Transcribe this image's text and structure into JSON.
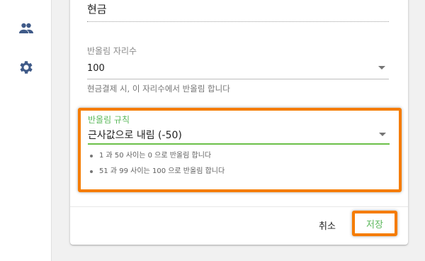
{
  "sidebar": {
    "items": [
      {
        "icon": "users-icon"
      },
      {
        "icon": "gear-icon"
      }
    ]
  },
  "form": {
    "payment_method_value": "현금",
    "digits": {
      "label": "반올림 자리수",
      "value": "100",
      "hint": "현금결제 시, 이 자리수에서 반올림 합니다"
    },
    "rule": {
      "label": "반올림 규칙",
      "value": "근사값으로 내림 (-50)",
      "notes": [
        "1 과 50 사이는 0 으로 반올림 합니다",
        "51 과 99 사이는 100 으로 반올림 합니다"
      ]
    }
  },
  "actions": {
    "cancel_label": "취소",
    "save_label": "저장"
  },
  "colors": {
    "accent_green": "#5cb85c",
    "highlight_orange": "#f57c00",
    "icon_blue": "#3f5a88"
  }
}
